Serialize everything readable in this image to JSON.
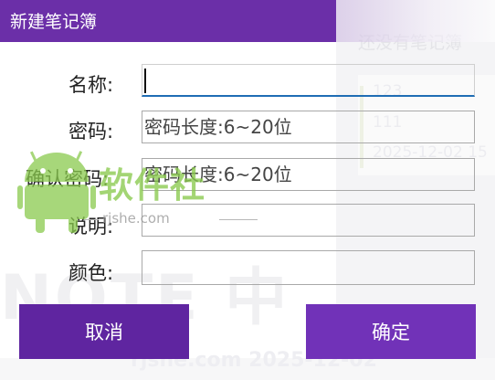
{
  "background": {
    "heading": "还没有笔记簿",
    "card_lines": [
      "123",
      "111",
      "2025-12-02 15"
    ],
    "large_text": "NOTE 中",
    "footer_date": "rjshe.com 2025-12-02"
  },
  "dialog": {
    "title": "新建笔记簿",
    "fields": {
      "name": {
        "label": "名称:",
        "value": "",
        "placeholder": ""
      },
      "password": {
        "label": "密码:",
        "value": "",
        "placeholder": "密码长度:6~20位"
      },
      "confirm": {
        "label": "确认密码:",
        "value": "",
        "placeholder": "密码长度:6~20位"
      },
      "desc": {
        "label": "说明:",
        "value": "",
        "placeholder": ""
      },
      "color": {
        "label": "颜色:",
        "value": "",
        "placeholder": ""
      }
    },
    "buttons": {
      "cancel": "取消",
      "ok": "确定"
    }
  },
  "watermark": {
    "name": "软件社",
    "domain": "rjshe.com"
  },
  "colors": {
    "accent": "#6b2fa8",
    "button_cancel": "#5f25a0",
    "button_ok": "#7132b8",
    "focus_underline": "#1f6db4",
    "watermark_green": "#8aca4e"
  },
  "icons": {
    "watermark_logo": "android-robot-icon"
  }
}
